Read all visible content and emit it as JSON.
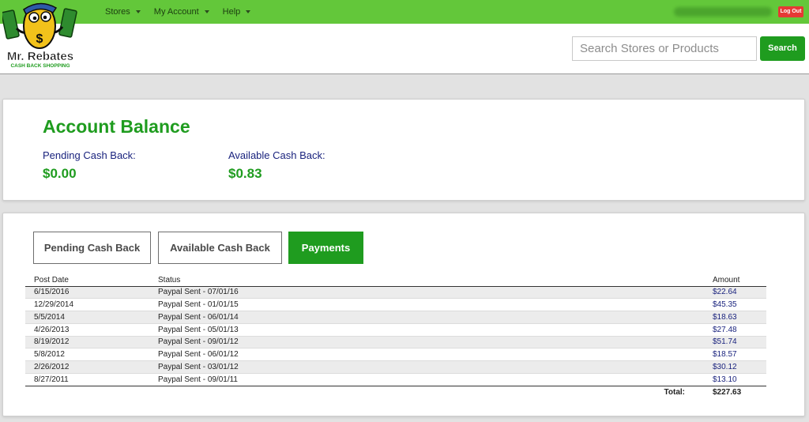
{
  "nav": {
    "items": [
      {
        "label": "Stores"
      },
      {
        "label": "My Account"
      },
      {
        "label": "Help"
      }
    ],
    "logout_label": "Log Out"
  },
  "logo": {
    "brand": "Mr. Rebates",
    "tagline": "CASH BACK SHOPPING"
  },
  "search": {
    "placeholder": "Search Stores or Products",
    "button_label": "Search"
  },
  "balance": {
    "title": "Account Balance",
    "pending_label": "Pending Cash Back:",
    "pending_value": "$0.00",
    "available_label": "Available Cash Back:",
    "available_value": "$0.83"
  },
  "tabs": [
    {
      "label": "Pending Cash Back",
      "active": false
    },
    {
      "label": "Available Cash Back",
      "active": false
    },
    {
      "label": "Payments",
      "active": true
    }
  ],
  "table": {
    "headers": {
      "date": "Post Date",
      "status": "Status",
      "amount": "Amount"
    },
    "rows": [
      {
        "date": "6/15/2016",
        "status": "Paypal Sent - 07/01/16",
        "amount": "$22.64"
      },
      {
        "date": "12/29/2014",
        "status": "Paypal Sent - 01/01/15",
        "amount": "$45.35"
      },
      {
        "date": "5/5/2014",
        "status": "Paypal Sent - 06/01/14",
        "amount": "$18.63"
      },
      {
        "date": "4/26/2013",
        "status": "Paypal Sent - 05/01/13",
        "amount": "$27.48"
      },
      {
        "date": "8/19/2012",
        "status": "Paypal Sent - 09/01/12",
        "amount": "$51.74"
      },
      {
        "date": "5/8/2012",
        "status": "Paypal Sent - 06/01/12",
        "amount": "$18.57"
      },
      {
        "date": "2/26/2012",
        "status": "Paypal Sent - 03/01/12",
        "amount": "$30.12"
      },
      {
        "date": "8/27/2011",
        "status": "Paypal Sent - 09/01/11",
        "amount": "$13.10"
      }
    ],
    "total_label": "Total:",
    "total_value": "$227.63"
  },
  "colors": {
    "topbar": "#63c73a",
    "brand_green": "#1f9c1f",
    "link_navy": "#1a237e",
    "logout_red": "#e53935"
  }
}
